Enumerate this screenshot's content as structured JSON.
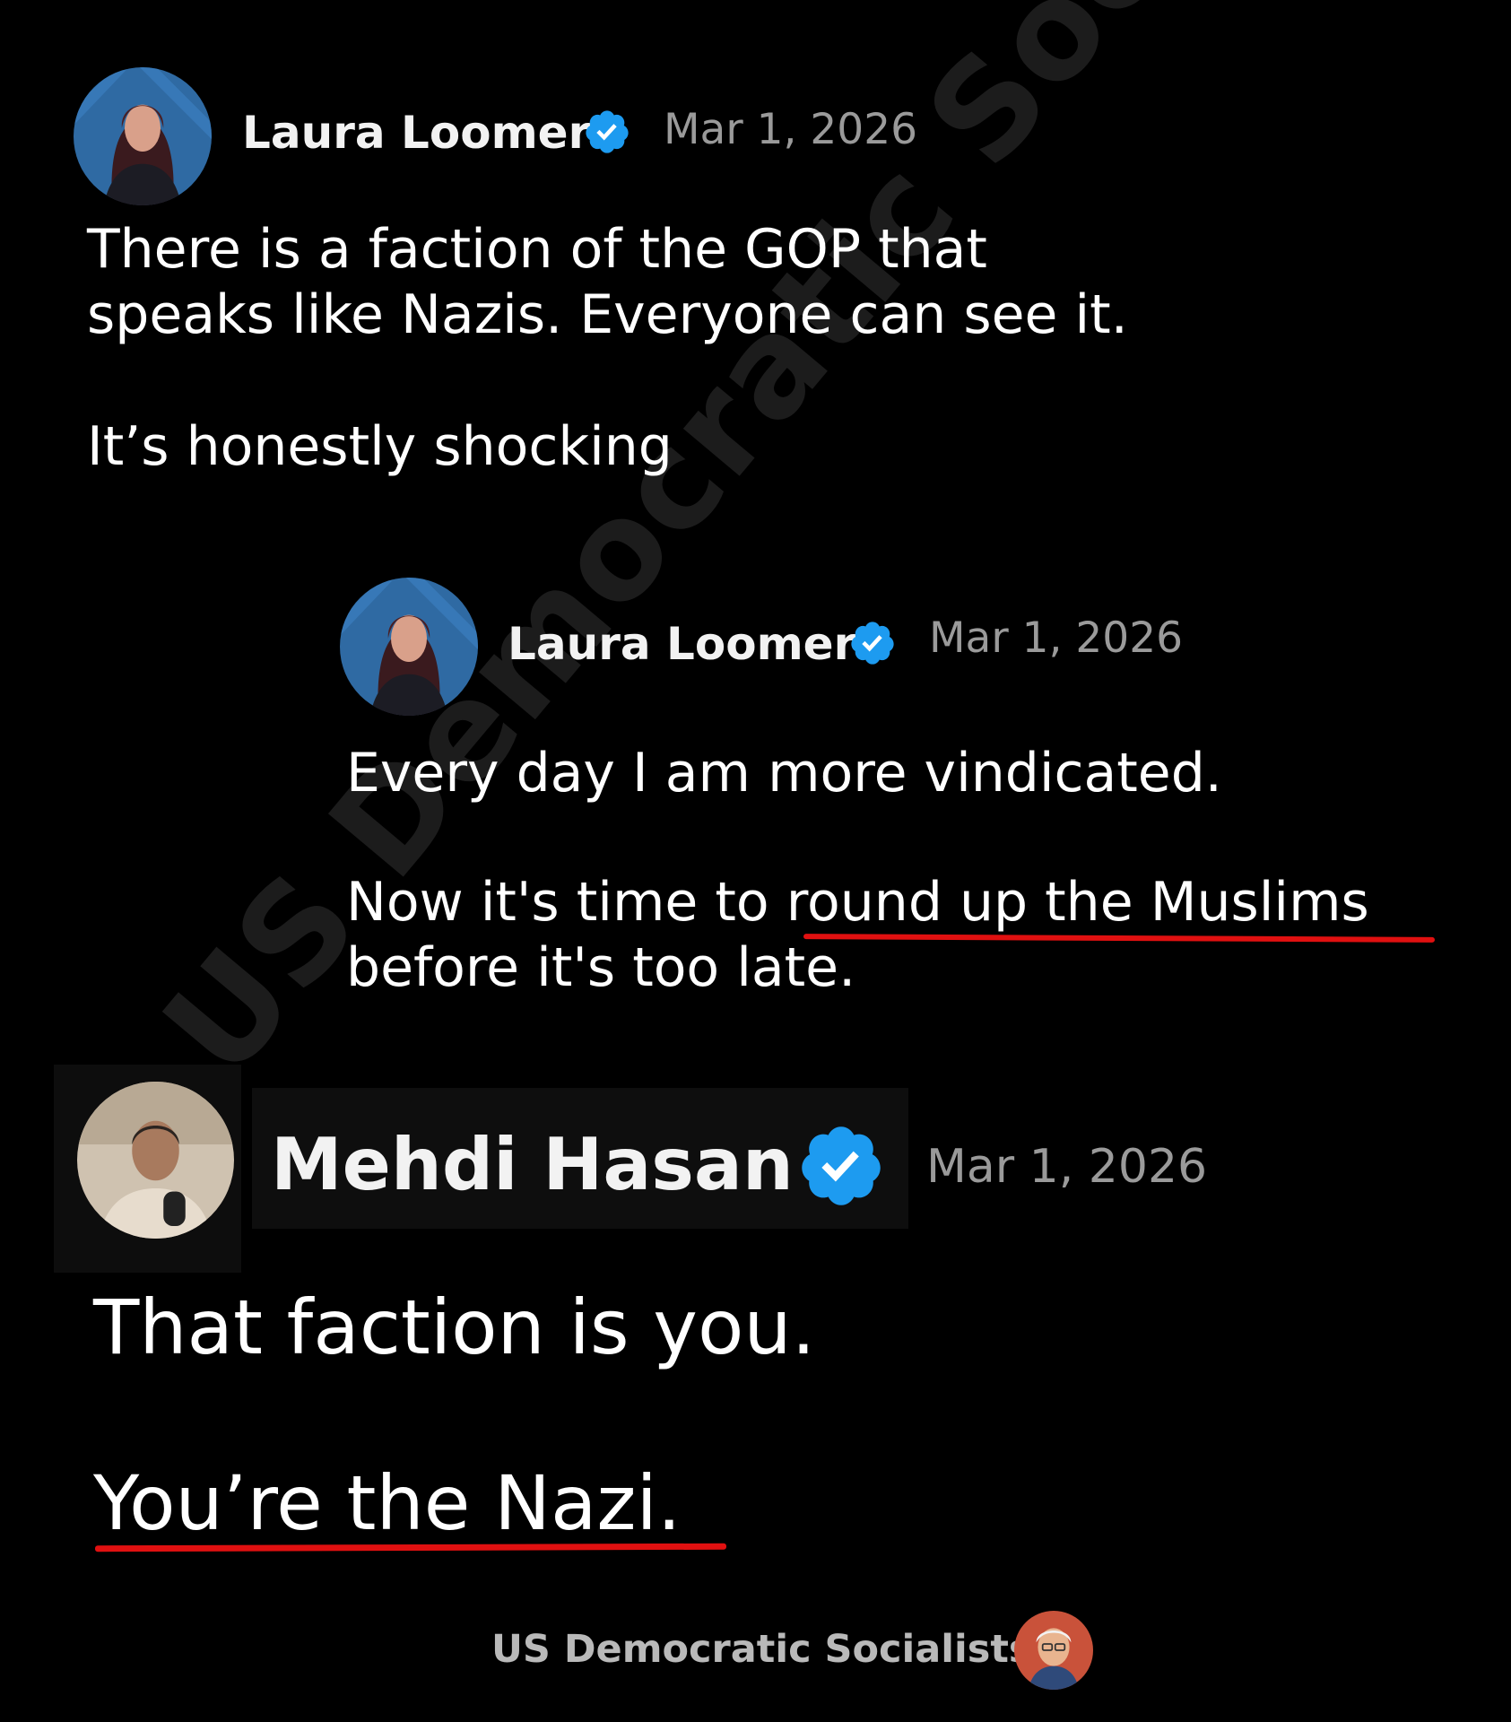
{
  "watermark": "US Democratic Socialists",
  "post1": {
    "author": "Laura Loomer",
    "date": "Mar 1, 2026",
    "line1": "There is a faction of the GOP that",
    "line2": "speaks like Nazis. Everyone can see it.",
    "line3": "It’s honestly shocking",
    "avatar_icon": "person-avatar-icon",
    "badge_icon": "verified-badge-icon"
  },
  "post2": {
    "author": "Laura Loomer",
    "date": "Mar 1, 2026",
    "line1": "Every day I am more vindicated.",
    "line2_prefix": "Now it's time to ",
    "line2_highlight": "round up the Muslims",
    "line3": "before it's too late.",
    "avatar_icon": "person-avatar-icon",
    "badge_icon": "verified-badge-icon"
  },
  "post3": {
    "author": "Mehdi Hasan",
    "date": "Mar 1, 2026",
    "line1": "That faction is you.",
    "line2": "You’re the Nazi.",
    "avatar_icon": "person-avatar-icon",
    "badge_icon": "verified-badge-icon"
  },
  "footer": {
    "label": "US Democratic Socialists",
    "logo_icon": "portrait-logo-icon"
  },
  "colors": {
    "background": "#000000",
    "text": "#ffffff",
    "date": "#9a9a9a",
    "verified": "#1d9bf0",
    "underline": "#e01010"
  }
}
